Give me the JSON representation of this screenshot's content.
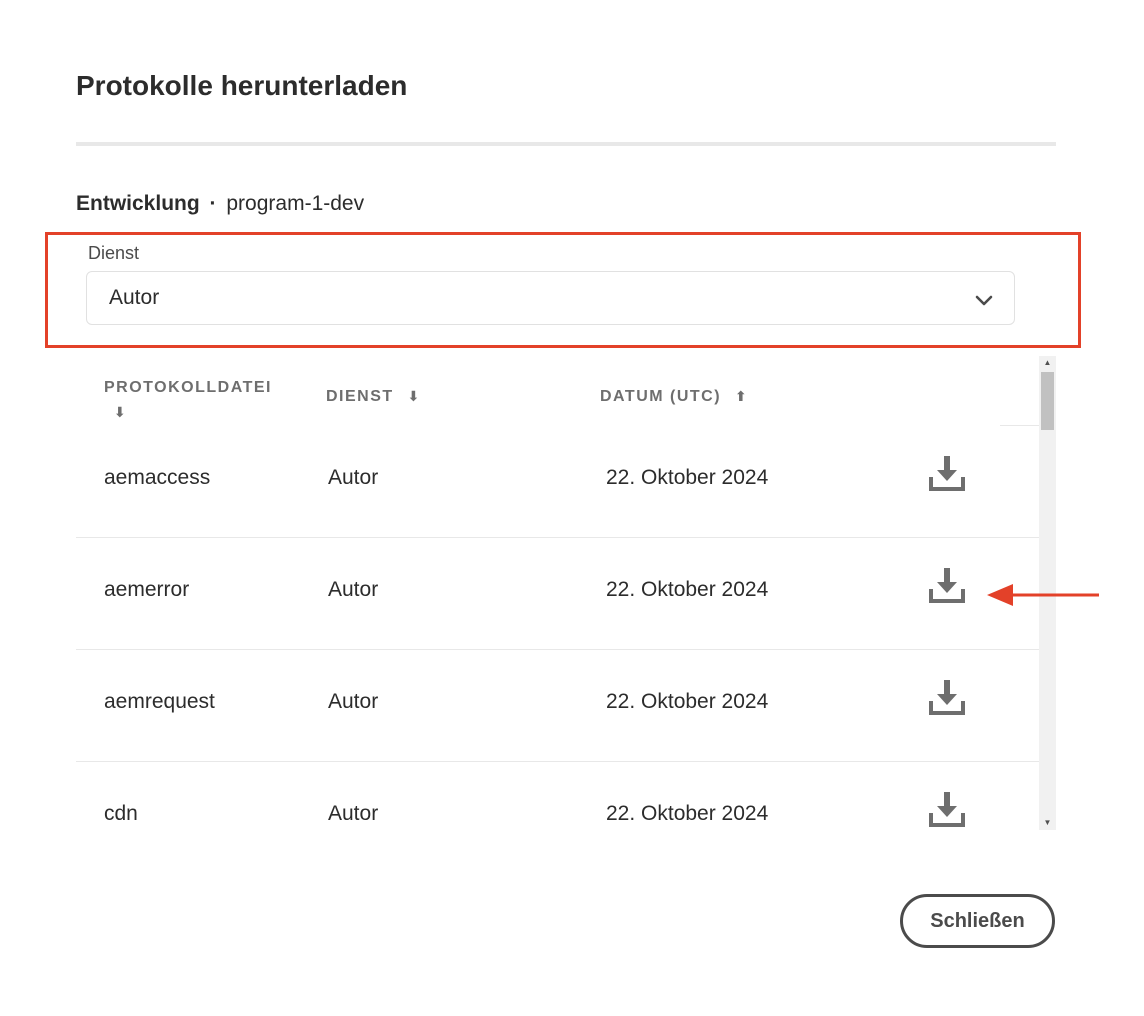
{
  "dialog": {
    "title": "Protokolle herunterladen",
    "environment_name": "Entwicklung",
    "separator": "·",
    "environment_id": "program-1-dev"
  },
  "service_select": {
    "label": "Dienst",
    "value": "Autor"
  },
  "table": {
    "headers": {
      "file": "PROTOKOLLDATEI",
      "service": "DIENST",
      "date": "DATUM (UTC)"
    },
    "sort_icons": {
      "file": "⬇",
      "service": "⬇",
      "date": "⬆"
    },
    "rows": [
      {
        "file": "aemaccess",
        "service": "Autor",
        "date": "22. Oktober 2024"
      },
      {
        "file": "aemerror",
        "service": "Autor",
        "date": "22. Oktober 2024"
      },
      {
        "file": "aemrequest",
        "service": "Autor",
        "date": "22. Oktober 2024"
      },
      {
        "file": "cdn",
        "service": "Autor",
        "date": "22. Oktober 2024"
      }
    ]
  },
  "footer": {
    "close_label": "Schließen"
  },
  "colors": {
    "annotation_red": "#e34129",
    "icon_gray": "#6e6e6e",
    "text_dark": "#2c2c2c"
  },
  "icons": {
    "select": "chevron-down-icon",
    "row_action": "download-icon",
    "annotation": "arrow-left-icon"
  }
}
